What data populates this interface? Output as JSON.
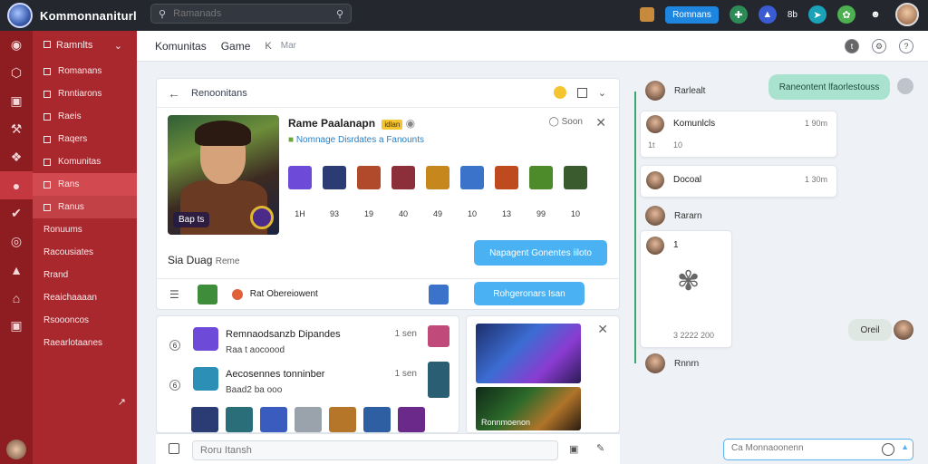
{
  "app": {
    "title": "Kommonnaniturl"
  },
  "search": {
    "placeholder": "Ramanads",
    "value": ""
  },
  "topbar": {
    "button_label": "Romnans",
    "count": "8b"
  },
  "sidebar": {
    "header": "Ramnlts",
    "items": [
      {
        "label": "Romanans"
      },
      {
        "label": "Rnntiarons"
      },
      {
        "label": "Raeis"
      },
      {
        "label": "Raqers"
      },
      {
        "label": "Komunitas"
      },
      {
        "label": "Rans"
      },
      {
        "label": "Ranus"
      },
      {
        "label": "Ronuums"
      },
      {
        "label": "Racousiates"
      },
      {
        "label": "Rrand"
      },
      {
        "label": "Reaichaaaan"
      },
      {
        "label": "Rsoooncos"
      },
      {
        "label": "Raearlotaanes"
      }
    ],
    "active_index": 6,
    "arrow": "↗"
  },
  "header": {
    "crumb1": "Komunitas",
    "crumb2": "Game",
    "crumb3": "Mar",
    "back_glyph": "K"
  },
  "main_panel": {
    "header_title": "Renoonitans",
    "game": {
      "title": "Rame Paalanapn",
      "tag": "idlan",
      "subtitle": "Nomnage Disrdates a Fanounts",
      "online": "Soon",
      "hero_badge": "Bap ts"
    },
    "items": [
      {
        "count": "1H",
        "color": "#6d4bd8"
      },
      {
        "count": "93",
        "color": "#2b3c74"
      },
      {
        "count": "19",
        "color": "#b04a2a"
      },
      {
        "count": "40",
        "color": "#8c2f3b"
      },
      {
        "count": "49",
        "color": "#c6881c"
      },
      {
        "count": "10",
        "color": "#3a73c9"
      },
      {
        "count": "13",
        "color": "#c04a1f"
      },
      {
        "count": "99",
        "color": "#4c8a2a"
      },
      {
        "count": "10",
        "color": "#3a5b2e"
      }
    ],
    "stats_label": "Sia Duag",
    "stats_small": "Reme",
    "primary_button": "Napagent Gonentes iiloto",
    "footer_player": "Rat Obereiowent",
    "footer_button": "Rohgeronars Isan"
  },
  "feed": {
    "posts": [
      {
        "name": "Remnaodsanzb Dipandes",
        "meta": "Raa t aocoood",
        "time": "1 sen",
        "bullet": "6"
      },
      {
        "name": "Aecosennes tonninber",
        "meta": "Baad2 ba ooo",
        "time": "1 sen",
        "bullet": "6"
      }
    ]
  },
  "media": {
    "label": "Ronnmoenon"
  },
  "composer": {
    "placeholder": "Roru Itansh"
  },
  "chat": {
    "pill": "Raneontent lfaorlestouss",
    "messages": [
      {
        "name": "Rarlealt"
      },
      {
        "name": "Komunlcls",
        "time": "1 90m",
        "meta1": "1t",
        "meta2": "10"
      },
      {
        "name": "Docoal",
        "time": "1 30m"
      },
      {
        "name": "Rararn"
      },
      {
        "name": "1",
        "time": "3 2222 200"
      },
      {
        "name": "Rnnrn"
      }
    ],
    "reply": "Oreil",
    "input_placeholder": "Ca Monnaoonenn"
  }
}
